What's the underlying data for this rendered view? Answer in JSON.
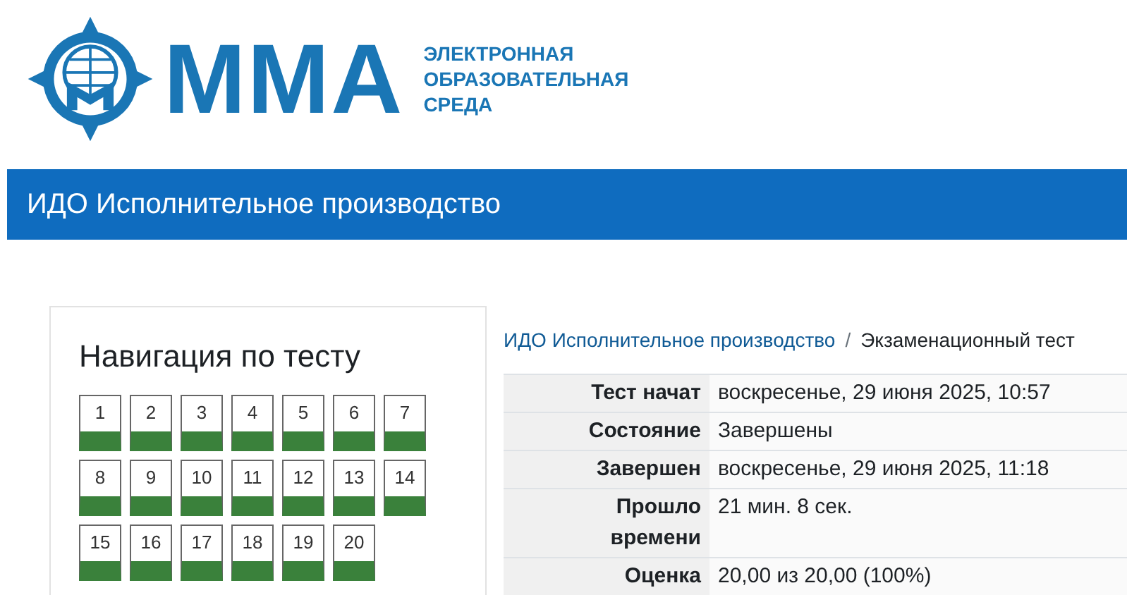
{
  "logo": {
    "mark": "ММА",
    "subtitle": [
      "ЭЛЕКТРОННАЯ",
      "ОБРАЗОВАТЕЛЬНАЯ",
      "СРЕДА"
    ]
  },
  "header": {
    "title": "ИДО Исполнительное производство"
  },
  "navigation": {
    "title": "Навигация по тесту",
    "questions": [
      {
        "label": "1",
        "correct": true
      },
      {
        "label": "2",
        "correct": true
      },
      {
        "label": "3",
        "correct": true
      },
      {
        "label": "4",
        "correct": true
      },
      {
        "label": "5",
        "correct": true
      },
      {
        "label": "6",
        "correct": true
      },
      {
        "label": "7",
        "correct": true
      },
      {
        "label": "8",
        "correct": true
      },
      {
        "label": "9",
        "correct": true
      },
      {
        "label": "10",
        "correct": true
      },
      {
        "label": "11",
        "correct": true
      },
      {
        "label": "12",
        "correct": true
      },
      {
        "label": "13",
        "correct": true
      },
      {
        "label": "14",
        "correct": true
      },
      {
        "label": "15",
        "correct": true
      },
      {
        "label": "16",
        "correct": true
      },
      {
        "label": "17",
        "correct": true
      },
      {
        "label": "18",
        "correct": true
      },
      {
        "label": "19",
        "correct": true
      },
      {
        "label": "20",
        "correct": true
      }
    ]
  },
  "breadcrumb": {
    "items": [
      {
        "label": "ИДО Исполнительное производство",
        "kind": "link"
      },
      {
        "label": "Экзаменационный тест",
        "kind": "current"
      }
    ],
    "separator": "/"
  },
  "summary": {
    "rows": [
      {
        "label": "Тест начат",
        "value": "воскресенье, 29 июня 2025, 10:57"
      },
      {
        "label": "Состояние",
        "value": "Завершены"
      },
      {
        "label": "Завершен",
        "value": "воскресенье, 29 июня 2025, 11:18"
      },
      {
        "label": "Прошло времени",
        "value": "21 мин. 8 сек."
      },
      {
        "label": "Оценка",
        "value": "20,00 из 20,00 (100%)"
      }
    ]
  }
}
